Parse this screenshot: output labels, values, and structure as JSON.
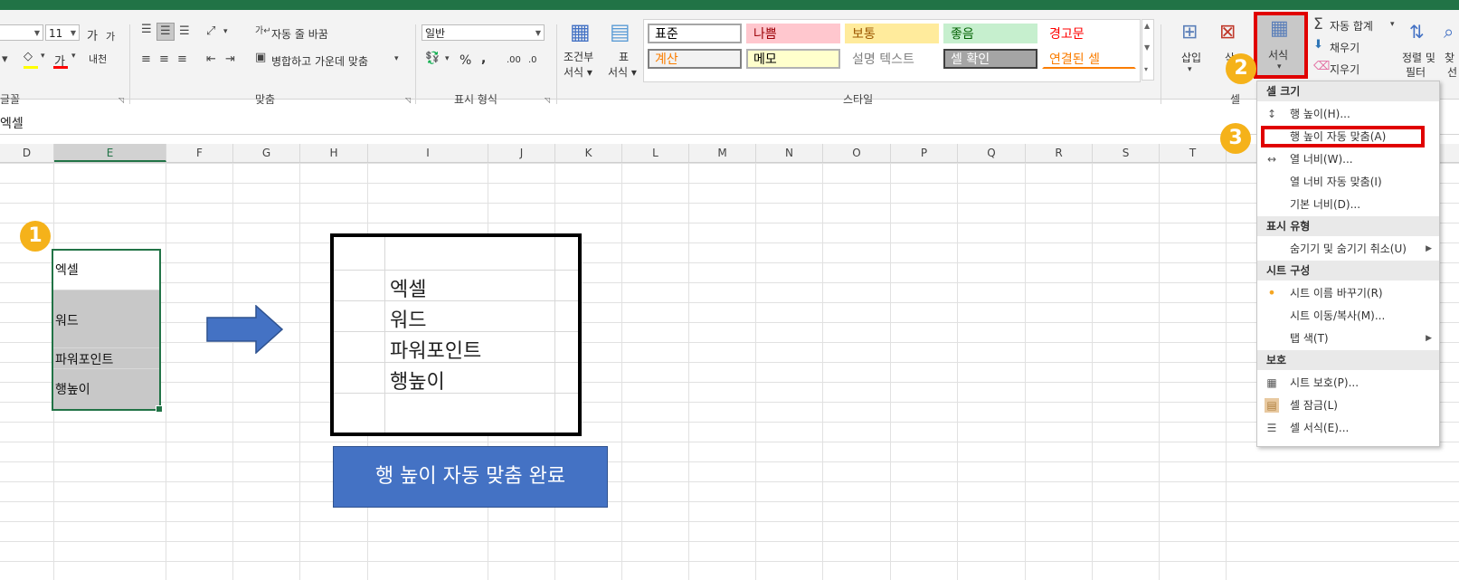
{
  "ribbon": {
    "font_size": "11",
    "grow_font": "가",
    "shrink_font": "가",
    "font_color_label": "가",
    "phonetic_label": "내천",
    "wrap_text": "자동 줄 바꿈",
    "merge_center": "병합하고 가운데 맞춤",
    "number_format": "일반",
    "percent": "%",
    "comma": ",",
    "dec_inc": ".00",
    "dec_dec": ".0",
    "conditional_format": [
      "조건부",
      "서식 ▾"
    ],
    "format_table": [
      "표",
      "서식 ▾"
    ],
    "styles": [
      {
        "label": "표준",
        "bg": "#ffffff",
        "fg": "#000000",
        "border": "#a6a6a6"
      },
      {
        "label": "나쁨",
        "bg": "#ffc7ce",
        "fg": "#9c0006",
        "border": "#ffc7ce"
      },
      {
        "label": "보통",
        "bg": "#ffeb9c",
        "fg": "#9c5700",
        "border": "#ffeb9c"
      },
      {
        "label": "좋음",
        "bg": "#c6efce",
        "fg": "#006100",
        "border": "#c6efce"
      },
      {
        "label": "경고문",
        "bg": "#ffffff",
        "fg": "#ff0000",
        "border": "#ffffff"
      },
      {
        "label": "계산",
        "bg": "#f2f2f2",
        "fg": "#fa7d00",
        "border": "#7f7f7f"
      },
      {
        "label": "메모",
        "bg": "#ffffcc",
        "fg": "#000000",
        "border": "#b2b2b2"
      },
      {
        "label": "설명 텍스트",
        "bg": "#ffffff",
        "fg": "#7f7f7f",
        "border": "#ffffff"
      },
      {
        "label": "셀 확인",
        "bg": "#a5a5a5",
        "fg": "#ffffff",
        "border": "#3f3f3f"
      },
      {
        "label": "연결된 셀",
        "bg": "#ffffff",
        "fg": "#fa7d00",
        "border": "#ffffff"
      }
    ],
    "insert": "삽입",
    "delete": "삭",
    "format": "서식",
    "autosum": "자동 합계",
    "fill": "채우기",
    "clear": "지우기",
    "sort_filter": [
      "정렬 및",
      "필터"
    ],
    "find": [
      "찾",
      "선"
    ],
    "groups": {
      "font": "글꼴",
      "alignment": "맞춤",
      "number": "표시 형식",
      "styles": "스타일",
      "cells": "셀"
    }
  },
  "formula_bar": {
    "content": "엑셀"
  },
  "columns": [
    {
      "label": "D"
    },
    {
      "label": "E"
    },
    {
      "label": "F"
    },
    {
      "label": "G"
    },
    {
      "label": "H"
    },
    {
      "label": "I"
    },
    {
      "label": "J"
    },
    {
      "label": "K"
    },
    {
      "label": "L"
    },
    {
      "label": "M"
    },
    {
      "label": "N"
    },
    {
      "label": "O"
    },
    {
      "label": "P"
    },
    {
      "label": "Q"
    },
    {
      "label": "R"
    },
    {
      "label": "S"
    },
    {
      "label": "T"
    }
  ],
  "left_cells": [
    "엑셀",
    "워드",
    "파워포인트",
    "행높이"
  ],
  "result_cells": [
    "엑셀",
    "워드",
    "파워포인트",
    "행높이"
  ],
  "completion_label": "행 높이 자동 맞춤 완료",
  "badges": [
    "1",
    "2",
    "3"
  ],
  "menu": {
    "sections": [
      {
        "header": "셀 크기",
        "items": [
          {
            "label": "행 높이(H)...",
            "icon": "row-height-icon",
            "glyph": "↕"
          },
          {
            "label": "행 높이 자동 맞춤(A)",
            "icon": "",
            "glyph": ""
          },
          {
            "label": "열 너비(W)...",
            "icon": "column-width-icon",
            "glyph": "↔"
          },
          {
            "label": "열 너비 자동 맞춤(I)",
            "icon": "",
            "glyph": ""
          },
          {
            "label": "기본 너비(D)...",
            "icon": "",
            "glyph": ""
          }
        ]
      },
      {
        "header": "표시 유형",
        "items": [
          {
            "label": "숨기기 및 숨기기 취소(U)",
            "icon": "",
            "glyph": "",
            "submenu": true
          }
        ]
      },
      {
        "header": "시트 구성",
        "items": [
          {
            "label": "시트 이름 바꾸기(R)",
            "icon": "bullet-icon",
            "glyph": "•"
          },
          {
            "label": "시트 이동/복사(M)...",
            "icon": "",
            "glyph": ""
          },
          {
            "label": "탭 색(T)",
            "icon": "",
            "glyph": "",
            "submenu": true
          }
        ]
      },
      {
        "header": "보호",
        "items": [
          {
            "label": "시트 보호(P)...",
            "icon": "protect-sheet-icon",
            "glyph": "▦"
          },
          {
            "label": "셀 잠금(L)",
            "icon": "lock-cell-icon",
            "glyph": "▤"
          },
          {
            "label": "셀 서식(E)...",
            "icon": "format-cells-icon",
            "glyph": "☰"
          }
        ]
      }
    ]
  },
  "colors": {
    "excel_green": "#217346",
    "highlight_red": "#e00000",
    "badge_orange": "#f5b21a",
    "arrow_blue": "#4472c4",
    "selected_gray": "#c8c8c8"
  }
}
